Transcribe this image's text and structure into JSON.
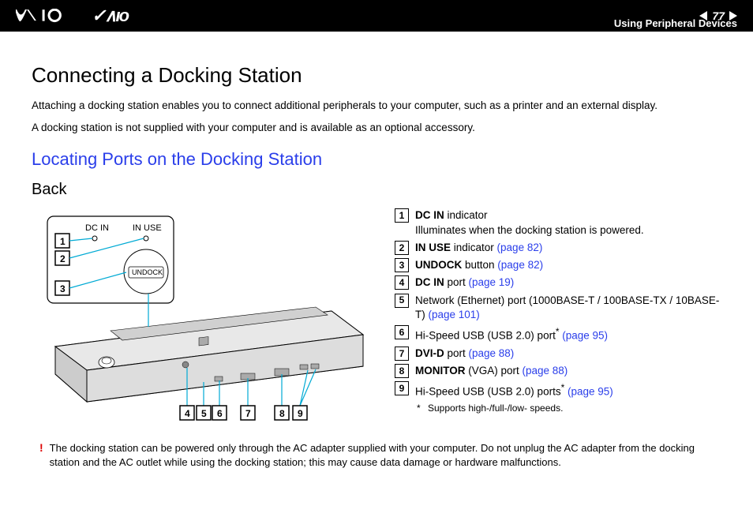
{
  "header": {
    "page_number": "77",
    "breadcrumb": "Using Peripheral Devices"
  },
  "title": "Connecting a Docking Station",
  "para1": "Attaching a docking station enables you to connect additional peripherals to your computer, such as a printer and an external display.",
  "para2": "A docking station is not supplied with your computer and is available as an optional accessory.",
  "subtitle": "Locating Ports on the Docking Station",
  "view_label": "Back",
  "diagram_labels": {
    "dc_in": "DC IN",
    "in_use": "IN USE",
    "undock": "UNDOCK"
  },
  "legend": [
    {
      "num": "1",
      "bold": "DC IN",
      "rest": " indicator",
      "line2": "Illuminates when the docking station is powered."
    },
    {
      "num": "2",
      "bold": "IN USE",
      "rest": " indicator ",
      "link": "(page 82)"
    },
    {
      "num": "3",
      "bold": "UNDOCK",
      "rest": " button ",
      "link": "(page 82)"
    },
    {
      "num": "4",
      "bold": "DC IN",
      "rest": " port ",
      "link": "(page 19)"
    },
    {
      "num": "5",
      "rest_pre": "Network (Ethernet) port (1000BASE-T / 100BASE-TX / 10BASE-T) ",
      "link": "(page 101)"
    },
    {
      "num": "6",
      "rest_pre": "Hi-Speed USB (USB 2.0) port",
      "sup": "*",
      "rest": " ",
      "link": "(page 95)"
    },
    {
      "num": "7",
      "bold": "DVI-D",
      "rest": " port ",
      "link": "(page 88)"
    },
    {
      "num": "8",
      "bold": "MONITOR",
      "rest": " (VGA) port ",
      "link": "(page 88)"
    },
    {
      "num": "9",
      "rest_pre": "Hi-Speed USB (USB 2.0) ports",
      "sup": "*",
      "rest": " ",
      "link": "(page 95)"
    }
  ],
  "footnote_mark": "*",
  "footnote": "Supports high-/full-/low- speeds.",
  "warning_mark": "!",
  "warning": "The docking station can be powered only through the AC adapter supplied with your computer. Do not unplug the AC adapter from the docking station and the AC outlet while using the docking station; this may cause data damage or hardware malfunctions."
}
